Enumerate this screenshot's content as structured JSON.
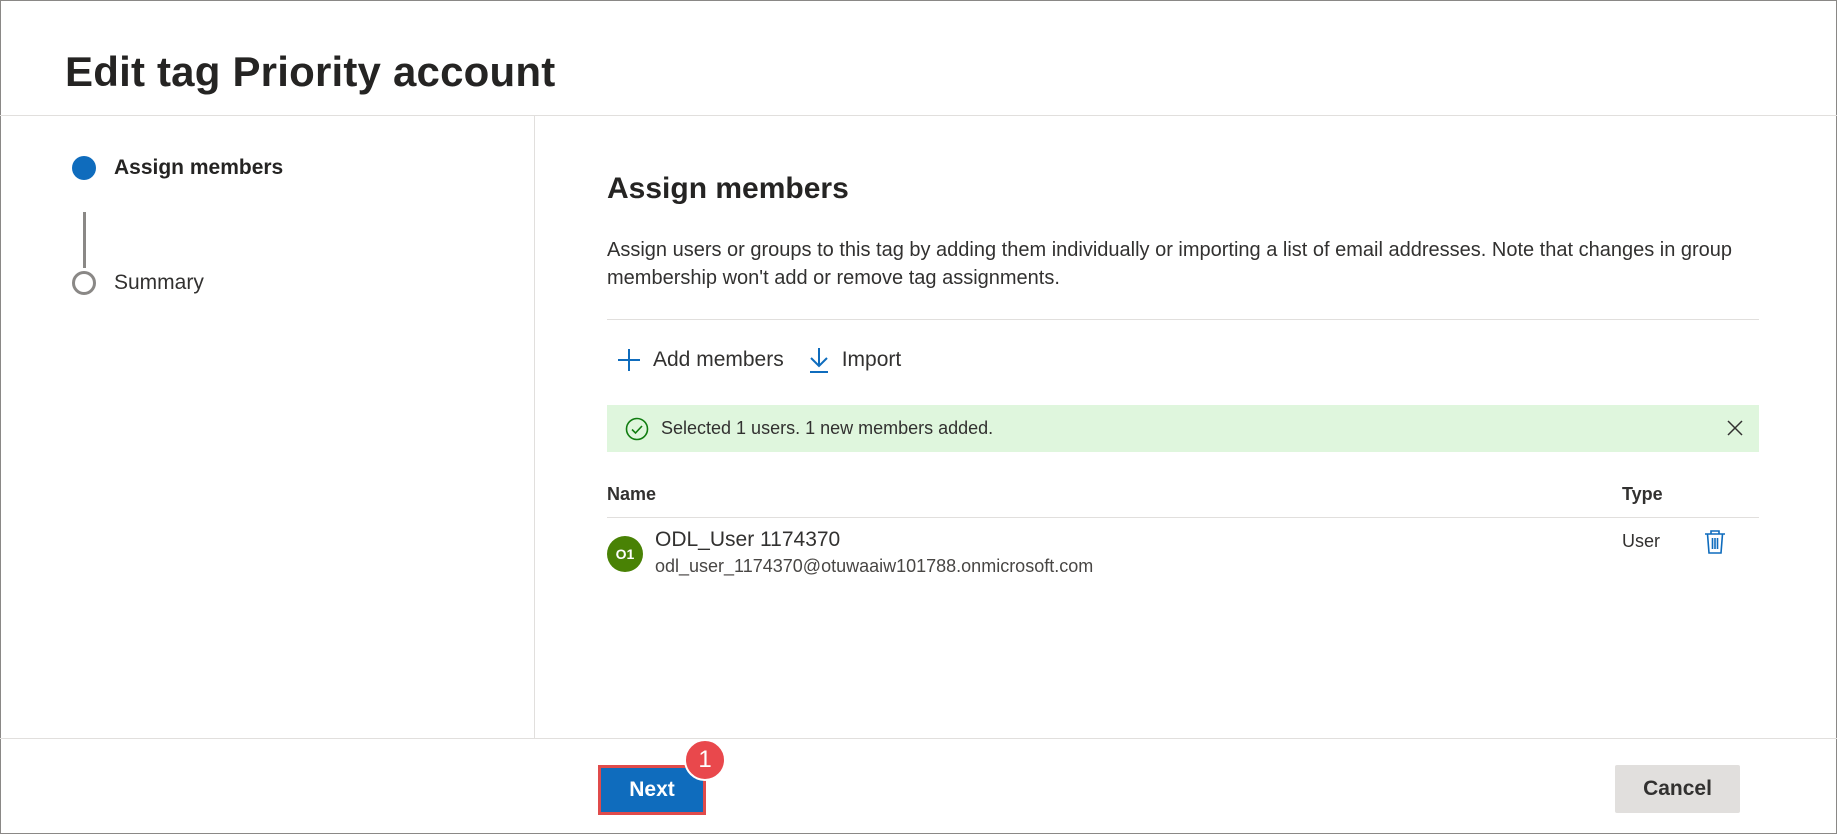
{
  "page": {
    "title": "Edit tag Priority account"
  },
  "stepper": {
    "steps": [
      {
        "label": "Assign members",
        "state": "active"
      },
      {
        "label": "Summary",
        "state": "inactive"
      }
    ]
  },
  "content": {
    "title": "Assign members",
    "description": "Assign users or groups to this tag by adding them individually or importing a list of email addresses. Note that changes in group membership won't add or remove tag assignments.",
    "commands": {
      "add_label": "Add members",
      "import_label": "Import"
    },
    "banner": {
      "message": "Selected 1 users. 1 new members added.",
      "color": "#dff6dd"
    },
    "table": {
      "columns": {
        "name": "Name",
        "type": "Type"
      },
      "rows": [
        {
          "initials": "O1",
          "name": "ODL_User 1174370",
          "email": "odl_user_1174370@otuwaaiw101788.onmicrosoft.com",
          "type": "User"
        }
      ]
    }
  },
  "footer": {
    "next_label": "Next",
    "cancel_label": "Cancel",
    "callout_number": "1"
  },
  "colors": {
    "accent": "#0f6cbd",
    "success": "#107c10",
    "avatar": "#498205",
    "callout": "#e9484c"
  }
}
